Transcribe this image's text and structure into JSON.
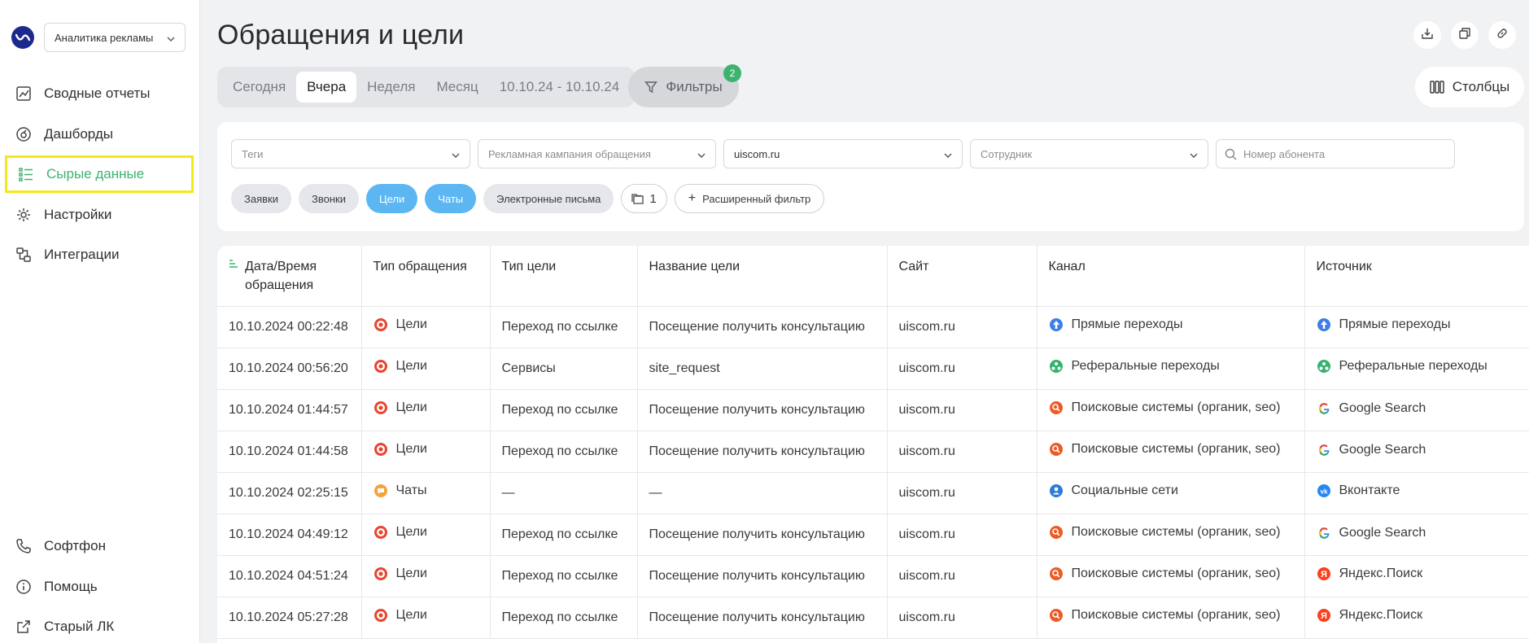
{
  "sidebar": {
    "product_select": "Аналитика рекламы",
    "nav": [
      {
        "label": "Сводные отчеты",
        "icon": "chart-icon"
      },
      {
        "label": "Дашборды",
        "icon": "dashboard-icon"
      },
      {
        "label": "Сырые данные",
        "icon": "raw-data-icon",
        "active": true
      },
      {
        "label": "Настройки",
        "icon": "gear-icon"
      },
      {
        "label": "Интеграции",
        "icon": "integrations-icon"
      }
    ],
    "bottom": [
      {
        "label": "Софтфон",
        "icon": "phone-icon"
      },
      {
        "label": "Помощь",
        "icon": "info-icon"
      },
      {
        "label": "Старый ЛК",
        "icon": "external-link-icon"
      }
    ]
  },
  "header": {
    "title": "Обращения и цели",
    "periods": [
      "Сегодня",
      "Вчера",
      "Неделя",
      "Месяц",
      "10.10.24 - 10.10.24"
    ],
    "active_period": "Вчера",
    "filters_label": "Фильтры",
    "filters_count": "2",
    "columns_label": "Столбцы"
  },
  "filters": {
    "tags_placeholder": "Теги",
    "campaign_placeholder": "Рекламная кампания обращения",
    "site_value": "uiscom.ru",
    "employee_placeholder": "Сотрудник",
    "search_placeholder": "Номер абонента",
    "chips": [
      {
        "label": "Заявки",
        "on": false
      },
      {
        "label": "Звонки",
        "on": false
      },
      {
        "label": "Цели",
        "on": true
      },
      {
        "label": "Чаты",
        "on": true
      },
      {
        "label": "Электронные письма",
        "on": false
      }
    ],
    "folder_count": "1",
    "advanced_label": "Расширенный фильтр"
  },
  "table": {
    "columns": [
      "Дата/Время обращения",
      "Тип обращения",
      "Тип цели",
      "Название цели",
      "Сайт",
      "Канал",
      "Источник"
    ],
    "rows": [
      {
        "date": "10.10.2024 00:22:48",
        "type": "Цели",
        "type_icon": "goal-icon",
        "goal_type": "Переход по ссылке",
        "goal_name": "Посещение получить консультацию",
        "site": "uiscom.ru",
        "channel": "Прямые переходы",
        "channel_icon": "direct-icon",
        "source": "Прямые переходы",
        "source_icon": "direct-icon"
      },
      {
        "date": "10.10.2024 00:56:20",
        "type": "Цели",
        "type_icon": "goal-icon",
        "goal_type": "Сервисы",
        "goal_name": "site_request",
        "site": "uiscom.ru",
        "channel": "Реферальные переходы",
        "channel_icon": "referral-icon",
        "source": "Реферальные переходы",
        "source_icon": "referral-icon"
      },
      {
        "date": "10.10.2024 01:44:57",
        "type": "Цели",
        "type_icon": "goal-icon",
        "goal_type": "Переход по ссылке",
        "goal_name": "Посещение получить консультацию",
        "site": "uiscom.ru",
        "channel": "Поисковые системы (органик, seo)",
        "channel_icon": "search-engine-icon",
        "source": "Google Search",
        "source_icon": "google-icon"
      },
      {
        "date": "10.10.2024 01:44:58",
        "type": "Цели",
        "type_icon": "goal-icon",
        "goal_type": "Переход по ссылке",
        "goal_name": "Посещение получить консультацию",
        "site": "uiscom.ru",
        "channel": "Поисковые системы (органик, seo)",
        "channel_icon": "search-engine-icon",
        "source": "Google Search",
        "source_icon": "google-icon"
      },
      {
        "date": "10.10.2024 02:25:15",
        "type": "Чаты",
        "type_icon": "chat-icon",
        "goal_type": "—",
        "goal_name": "—",
        "site": "uiscom.ru",
        "channel": "Социальные сети",
        "channel_icon": "social-icon",
        "source": "Вконтакте",
        "source_icon": "vk-icon"
      },
      {
        "date": "10.10.2024 04:49:12",
        "type": "Цели",
        "type_icon": "goal-icon",
        "goal_type": "Переход по ссылке",
        "goal_name": "Посещение получить консультацию",
        "site": "uiscom.ru",
        "channel": "Поисковые системы (органик, seo)",
        "channel_icon": "search-engine-icon",
        "source": "Google Search",
        "source_icon": "google-icon"
      },
      {
        "date": "10.10.2024 04:51:24",
        "type": "Цели",
        "type_icon": "goal-icon",
        "goal_type": "Переход по ссылке",
        "goal_name": "Посещение получить консультацию",
        "site": "uiscom.ru",
        "channel": "Поисковые системы (органик, seo)",
        "channel_icon": "search-engine-icon",
        "source": "Яндекс.Поиск",
        "source_icon": "yandex-icon"
      },
      {
        "date": "10.10.2024 05:27:28",
        "type": "Цели",
        "type_icon": "goal-icon",
        "goal_type": "Переход по ссылке",
        "goal_name": "Посещение получить консультацию",
        "site": "uiscom.ru",
        "channel": "Поисковые системы (органик, seo)",
        "channel_icon": "search-engine-icon",
        "source": "Яндекс.Поиск",
        "source_icon": "yandex-icon"
      }
    ]
  },
  "colors": {
    "accent_green": "#3db36f",
    "chip_blue": "#5cb6f2",
    "highlight_yellow": "#f3e81a",
    "goal_red": "#e8472f",
    "chat_orange": "#f5a33b"
  }
}
